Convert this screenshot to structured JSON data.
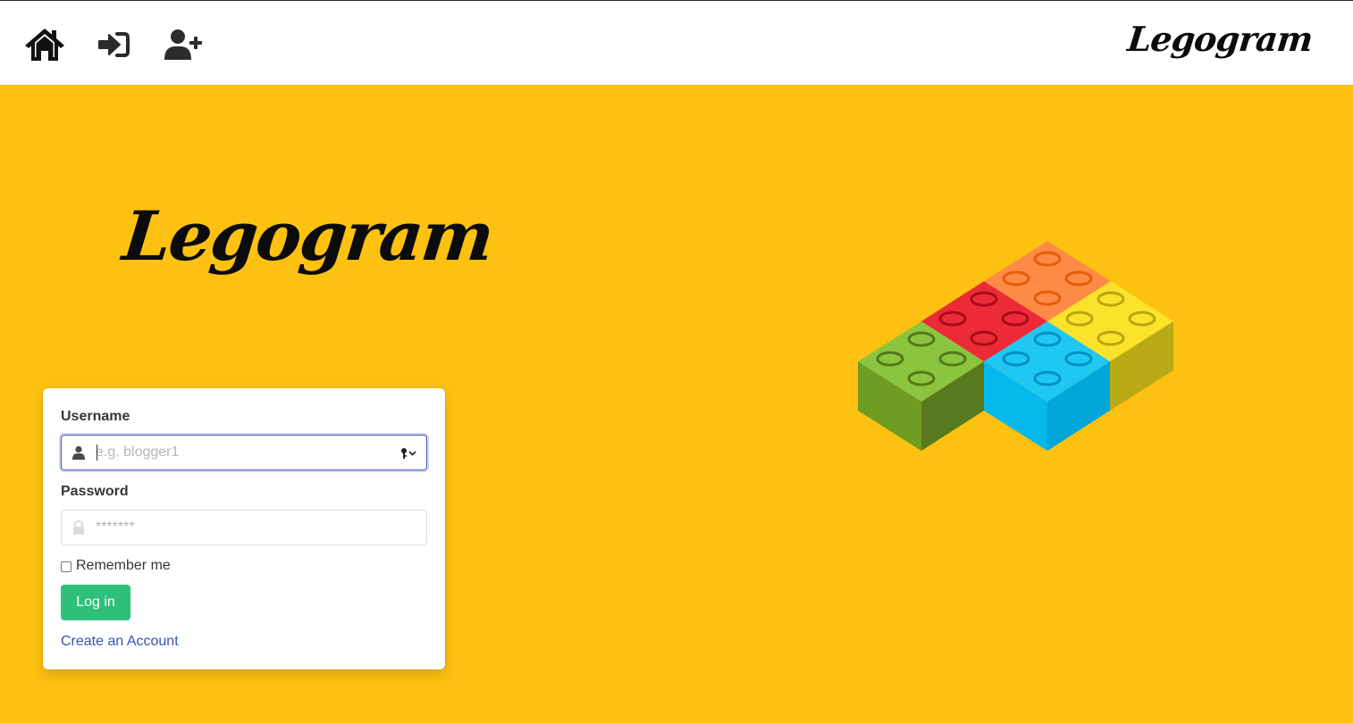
{
  "navbar": {
    "icons": [
      "home-icon",
      "sign-in-icon",
      "user-plus-icon"
    ],
    "brand": "Legogram"
  },
  "hero": {
    "logo_text": "Legogram",
    "illustration": "lego-bricks"
  },
  "login_form": {
    "username_label": "Username",
    "username_placeholder": "e.g. blogger1",
    "username_value": "",
    "password_label": "Password",
    "password_placeholder": "*******",
    "password_value": "",
    "remember_label": "Remember me",
    "remember_checked": false,
    "submit_label": "Log in",
    "create_account_label": "Create an Account"
  },
  "colors": {
    "background": "#fdc111",
    "primary_button": "#2ec07a",
    "link": "#3553b5",
    "focus_border": "#485fc7",
    "brick_green": "#8bc43f",
    "brick_red": "#ed2a37",
    "brick_orange": "#fd8b45",
    "brick_yellow": "#fae32a",
    "brick_blue": "#1ec8f3"
  }
}
